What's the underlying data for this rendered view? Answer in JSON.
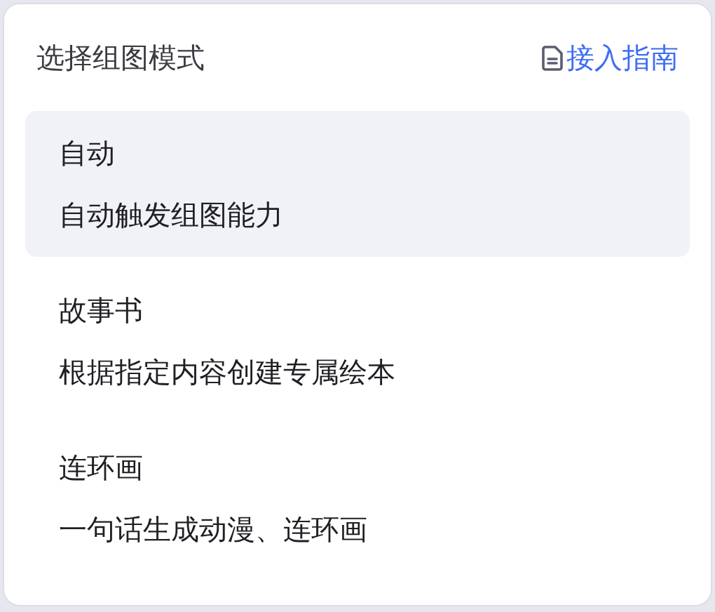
{
  "header": {
    "title": "选择组图模式",
    "guide_link": "接入指南"
  },
  "options": [
    {
      "title": "自动",
      "description": "自动触发组图能力",
      "selected": true
    },
    {
      "title": "故事书",
      "description": "根据指定内容创建专属绘本",
      "selected": false
    },
    {
      "title": "连环画",
      "description": "一句话生成动漫、连环画",
      "selected": false
    }
  ]
}
